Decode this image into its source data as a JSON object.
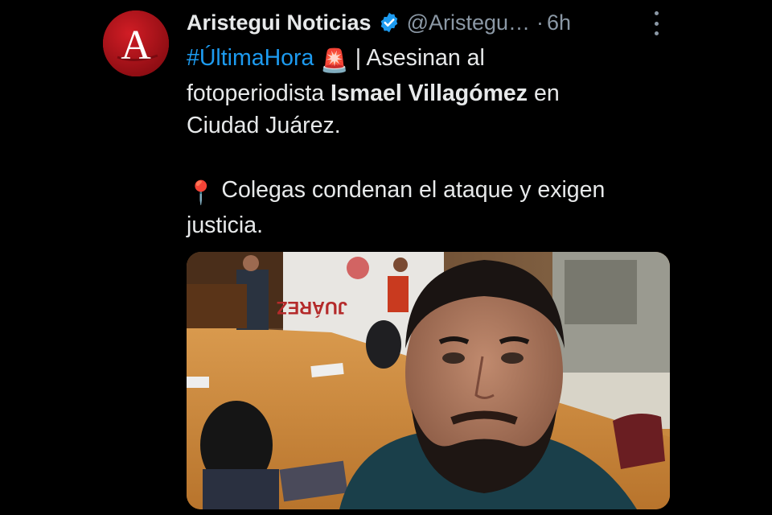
{
  "tweet": {
    "author_name": "Aristegui Noticias",
    "handle": "@Aristegu…",
    "separator": "·",
    "time": "6h",
    "avatar_letter": "A",
    "body": {
      "hashtag": "#ÚltimaHora",
      "siren": "🚨",
      "divider": " | ",
      "headline_part1": "Asesinan al",
      "headline_part2": "fotoperiodista ",
      "person_name": "Ismael Villagómez",
      "headline_part3": " en",
      "headline_part4": "Ciudad Juárez.",
      "pin": "📍",
      "subline_part1": " Colegas condenan el ataque y exigen",
      "subline_part2": "justicia."
    },
    "photo_banner_text": "JUÁREZ"
  },
  "colors": {
    "background": "#000000",
    "text": "#e7e9ea",
    "muted": "#8b98a5",
    "link": "#1d9bf0",
    "verified": "#1d9bf0",
    "avatar": "#b3131b"
  },
  "icons": {
    "verified": "verified-badge-icon",
    "more": "more-options-icon",
    "siren": "siren-emoji",
    "pin": "pin-emoji"
  }
}
